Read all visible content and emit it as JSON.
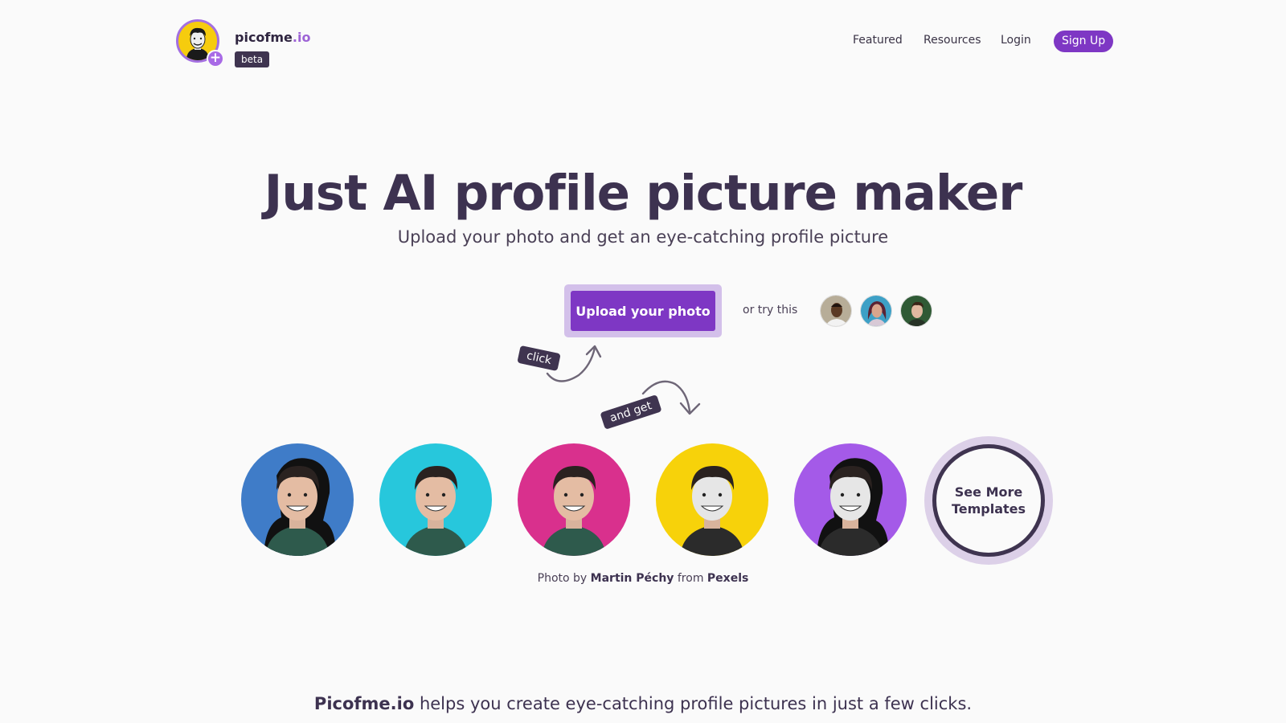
{
  "header": {
    "brand_name": "picofme",
    "brand_tld": ".io",
    "beta_label": "beta",
    "nav": [
      "Featured",
      "Resources",
      "Login"
    ],
    "signup_label": "Sign Up"
  },
  "hero": {
    "title": "Just AI profile picture maker",
    "subtitle": "Upload your photo and get an eye-catching profile picture",
    "upload_label": "Upload your photo",
    "try_label": "or try this",
    "click_tag": "click",
    "get_tag": "and get"
  },
  "templates": {
    "backgrounds": [
      "#3f7cc8",
      "#27c7dc",
      "#d9308d",
      "#f7d20a",
      "#a45ae8"
    ],
    "see_more_line1": "See More",
    "see_more_line2": "Templates"
  },
  "credit": {
    "prefix": "Photo by",
    "author": "Martin Péchy",
    "middle": "from",
    "source": "Pexels"
  },
  "about": {
    "brand": "Picofme.io",
    "text": " helps you create eye-catching profile pictures in just a few clicks."
  },
  "colors": {
    "accent": "#7e37c4",
    "dark": "#3f3450",
    "background": "#fafafa"
  }
}
